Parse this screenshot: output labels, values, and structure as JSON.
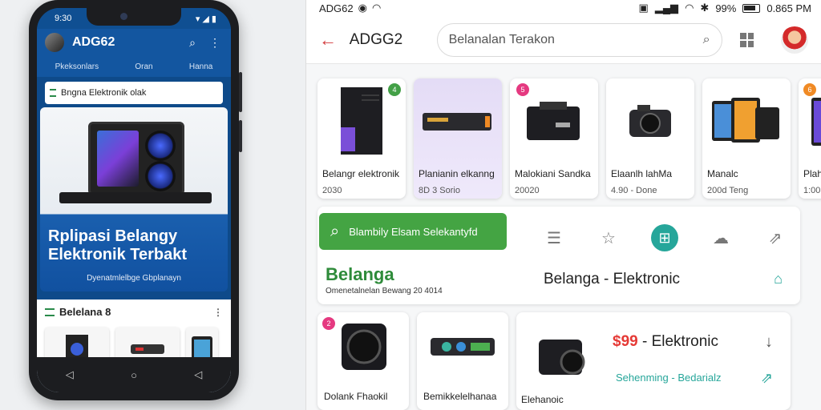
{
  "phone": {
    "status_time": "9:30",
    "app_title": "ADG62",
    "tabs": [
      "Pkeksonlars",
      "Oran",
      "Hanna"
    ],
    "search_text": "Bngna Elektronik olak",
    "hero_title_line1": "Rplipasi Belangy",
    "hero_title_line2": "Elektronik Terbakt",
    "hero_subtitle": "Dyenatmlelbge Gbplanayn",
    "section_title": "Belelana 8",
    "section_more": "⋮",
    "nav": [
      "◁",
      "○",
      "◁"
    ]
  },
  "status": {
    "left_label": "ADG62",
    "battery_pct": "99%",
    "time": "0.865 PM"
  },
  "appbar": {
    "title": "ADGG2",
    "search_placeholder": "Belanalan Terakon"
  },
  "cards": [
    {
      "name": "Belangr elektronik",
      "price": "2030",
      "badge": "4",
      "badge_color": "#43a047",
      "selected": false
    },
    {
      "name": "Planianin elkanng",
      "price": "8D 3 Sorio",
      "badge": "",
      "badge_color": "",
      "selected": true
    },
    {
      "name": "Malokiani Sandka",
      "price": "20020",
      "badge": "5",
      "badge_color": "#e53980",
      "selected": false
    },
    {
      "name": "Elaanlh lahMa",
      "price": "4.90 - Done",
      "badge": "",
      "badge_color": "",
      "selected": false
    },
    {
      "name": "Manalc",
      "price": "200d Teng",
      "badge": "",
      "badge_color": "",
      "selected": false
    },
    {
      "name": "Plah",
      "price": "1:00",
      "badge": "6",
      "badge_color": "#f08a24",
      "selected": false
    }
  ],
  "promo": {
    "button_text": "Blambily Elsam Selekantyfd",
    "brand": "Belanga",
    "brand_sub": "Omenetalnelan Bewang 20 4014",
    "center_text": "Belanga - Elektronic",
    "icons": [
      "list-icon",
      "star-icon",
      "grid-plus-icon",
      "chat-icon",
      "share-icon"
    ]
  },
  "bottom": [
    {
      "name": "Dolank Fhaokil",
      "badge": "2",
      "badge_color": "#e53980"
    },
    {
      "name": "Bemikkelelhanaa"
    }
  ],
  "big_card": {
    "price_red": "$99",
    "price_rest": " - Elektronic",
    "sub": "Sehenming - Bedarialz",
    "name": "Elehanoic",
    "icon_top": "↓",
    "icon_bottom": "⇗"
  }
}
